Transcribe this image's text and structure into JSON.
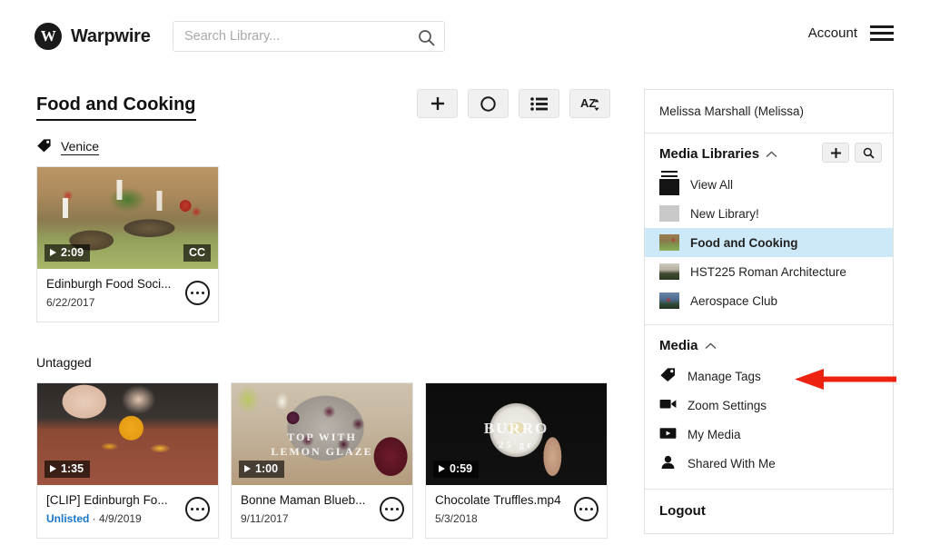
{
  "header": {
    "brand_mark": "W",
    "brand_name": "Warpwire",
    "search": {
      "value": "",
      "placeholder": "Search Library...",
      "icon": "search-icon"
    },
    "account_label": "Account",
    "menu_icon": "hamburger-icon"
  },
  "main": {
    "page_title": "Food and Cooking",
    "toolbar": [
      {
        "name": "add-media-button",
        "icon": "plus-icon"
      },
      {
        "name": "record-button",
        "icon": "circle-icon"
      },
      {
        "name": "list-view-button",
        "icon": "list-icon"
      },
      {
        "name": "sort-button",
        "icon": "sort-az-icon"
      }
    ],
    "groups": [
      {
        "label": "Venice",
        "icon": "tag-icon",
        "tagged": true
      },
      {
        "label": "Untagged",
        "icon": "",
        "tagged": false
      }
    ],
    "cards": [
      {
        "title": "Edinburgh Food Soci...",
        "duration": "2:09",
        "cc": "CC",
        "date": "6/22/2017",
        "status": "",
        "art": "art-market",
        "overlay": "",
        "menu_icon": "more-options-icon"
      },
      {
        "title": "[CLIP] Edinburgh Fo...",
        "duration": "1:35",
        "cc": "",
        "date": "4/9/2019",
        "status": "Unlisted",
        "separator": " · ",
        "art": "art-clip",
        "overlay": "",
        "menu_icon": "more-options-icon"
      },
      {
        "title": "Bonne Maman Blueb...",
        "duration": "1:00",
        "cc": "",
        "date": "9/11/2017",
        "status": "",
        "art": "art-rolls",
        "overlay": "TOP WITH",
        "overlay2": "LEMON GLAZE",
        "menu_icon": "more-options-icon"
      },
      {
        "title": "Chocolate Truffles.mp4",
        "duration": "0:59",
        "cc": "",
        "date": "5/3/2018",
        "status": "",
        "art": "art-dark",
        "overlay": "BURRO",
        "overlay2": "25 gr",
        "menu_icon": "more-options-icon"
      }
    ]
  },
  "sidebar": {
    "user": "Melissa Marshall (Melissa)",
    "libraries_heading": "Media Libraries",
    "libraries_collapse_icon": "chevron-up-icon",
    "library_actions": [
      {
        "name": "add-library-button",
        "icon": "plus-icon"
      },
      {
        "name": "search-library-button",
        "icon": "search-icon"
      }
    ],
    "libraries": [
      {
        "label": "View All",
        "thumb": "thumb-viewall",
        "active": false
      },
      {
        "label": "New Library!",
        "thumb": "thumb-grey",
        "active": false
      },
      {
        "label": "Food and Cooking",
        "thumb": "thumb-food",
        "active": true
      },
      {
        "label": "HST225 Roman Architecture",
        "thumb": "thumb-roman",
        "active": false
      },
      {
        "label": "Aerospace Club",
        "thumb": "thumb-aero",
        "active": false
      }
    ],
    "media_heading": "Media",
    "media_collapse_icon": "chevron-up-icon",
    "media_items": [
      {
        "label": "Manage Tags",
        "icon": "tag-icon"
      },
      {
        "label": "Zoom Settings",
        "icon": "video-camera-icon"
      },
      {
        "label": "My Media",
        "icon": "play-box-icon"
      },
      {
        "label": "Shared With Me",
        "icon": "person-icon"
      }
    ],
    "logout_label": "Logout"
  },
  "annotation": {
    "arrow_color": "#ee2211",
    "points_at": "Manage Tags"
  }
}
